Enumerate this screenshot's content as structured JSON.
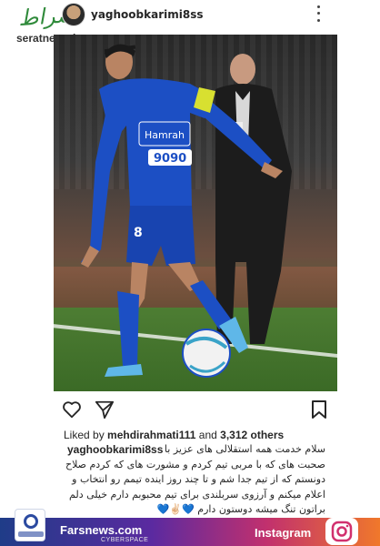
{
  "header": {
    "username": "yaghoobkarimi8ss",
    "watermark_logo_text": "صراط",
    "watermark_site": "seratnews.ir"
  },
  "post": {
    "image": {
      "jersey_number": "8",
      "jersey_sponsor_number": "9090"
    },
    "likes": {
      "prefix": "Liked by",
      "user": "mehdirahmati111",
      "conjunction": "and",
      "others": "3,312 others"
    },
    "caption": {
      "username": "yaghoobkarimi8ss",
      "lines": [
        "سلام خدمت همه استقلالی های عزیز  با",
        "صحبت های که با مربی تیم کردم  و مشورت های که کردم صلاح",
        "دونستم  که از تیم جدا شم و تا چند روز اینده تیمم رو انتخاب و",
        "اعلام میکنم  و آرزوی سربلندی برای تیم محبوبم دارم خیلی دلم",
        "براتون  تنگ میشه دوستون دارم 💙✌🏻💙"
      ]
    }
  },
  "footer": {
    "site": "Farsnews.com",
    "site_sub": "CYBERSPACE",
    "platform": "Instagram"
  },
  "colors": {
    "jersey": "#1c4fc4",
    "footer_start": "#1f3c88",
    "footer_end": "#f0782b",
    "watermark_green": "#2f8a3a"
  }
}
